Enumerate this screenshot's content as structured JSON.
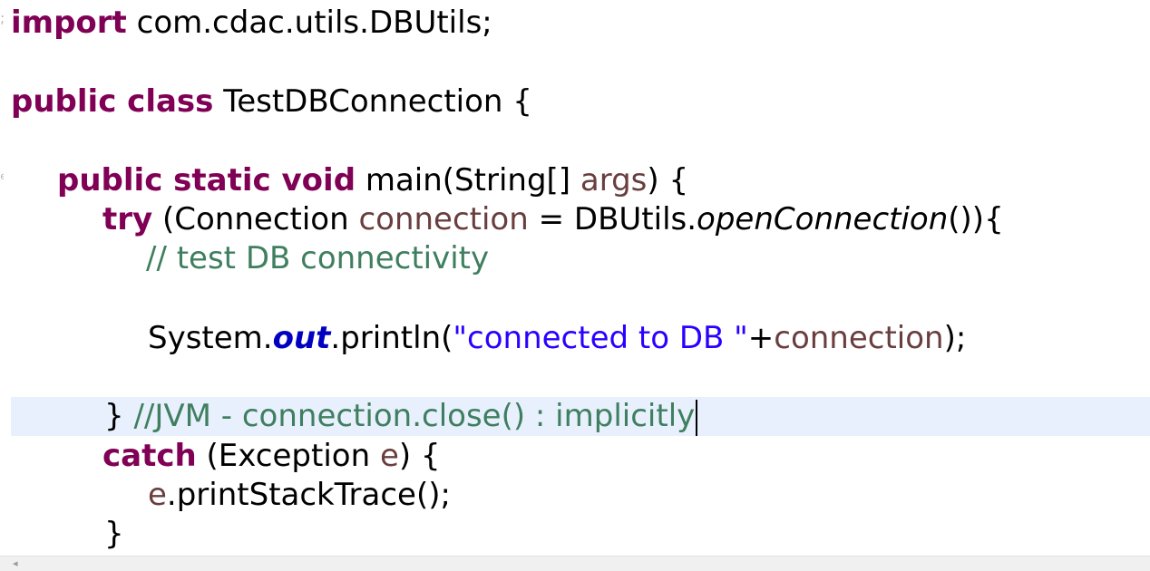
{
  "editor": {
    "lines": {
      "import_kw": "import",
      "import_rest": " com.cdac.utils.DBUtils;",
      "class_kw": "public class",
      "class_rest": " TestDBConnection {",
      "main_kw": "public static void",
      "main_a": " main(String[] ",
      "main_args": "args",
      "main_b": ") {",
      "try_kw": "try",
      "try_a": " (Connection ",
      "try_var": "connection",
      "try_b": " = DBUtils.",
      "try_method": "openConnection",
      "try_c": "()){",
      "comment1": "// test DB connectivity",
      "sys_a": "System.",
      "sys_field": "out",
      "sys_b": ".println(",
      "sys_str": "\"connected to DB \"",
      "sys_c": "+",
      "sys_var": "connection",
      "sys_d": ");",
      "close_brace": "}",
      "close_comment": " //JVM - connection.close() : implicitly",
      "catch_kw": "catch",
      "catch_a": " (Exception ",
      "catch_var": "e",
      "catch_b": ") {",
      "trace_var": "e",
      "trace_rest": ".printStackTrace();",
      "end_brace": "}"
    },
    "colors": {
      "keyword": "#7f0055",
      "local_variable": "#6a3e3e",
      "comment": "#3f7f5f",
      "string": "#2a00ff",
      "static_field": "#0000c0",
      "current_line": "#e8f0fd"
    }
  },
  "scrollbar": {
    "left_arrow_glyph": "◂"
  }
}
